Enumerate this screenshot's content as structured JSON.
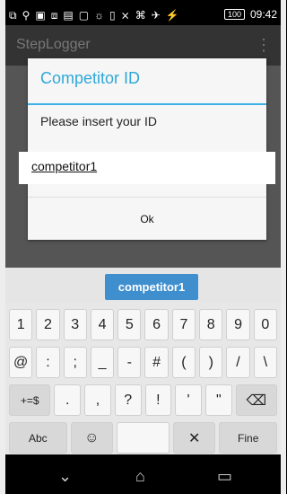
{
  "status": {
    "time": "09:42",
    "battery": "100",
    "left_icons": [
      "⧉",
      "⚲",
      "▣",
      "⧈",
      "▤",
      "▢",
      "☼",
      "▯",
      "⨯",
      "⌘",
      "✈",
      "⚡"
    ]
  },
  "app": {
    "title": "StepLogger",
    "overflow": "⋮"
  },
  "dialog": {
    "title": "Competitor ID",
    "message": "Please insert your ID",
    "input_value": "competitor1",
    "ok_label": "Ok"
  },
  "suggestions": {
    "selected": "competitor1"
  },
  "keyboard": {
    "row1": [
      "1",
      "2",
      "3",
      "4",
      "5",
      "6",
      "7",
      "8",
      "9",
      "0"
    ],
    "row2": [
      "@",
      ":",
      ";",
      "_",
      "-",
      "#",
      "(",
      ")",
      "/",
      "\\"
    ],
    "row3": [
      "+=$",
      ".",
      ",",
      "?",
      "!",
      "'",
      "\"",
      "⌫"
    ],
    "row4": {
      "abc": "Abc",
      "emoji": "☺",
      "mic": "✕",
      "fine": "Fine"
    }
  },
  "nav": {
    "back": "⌄",
    "home": "⌂",
    "recents": "▭"
  }
}
